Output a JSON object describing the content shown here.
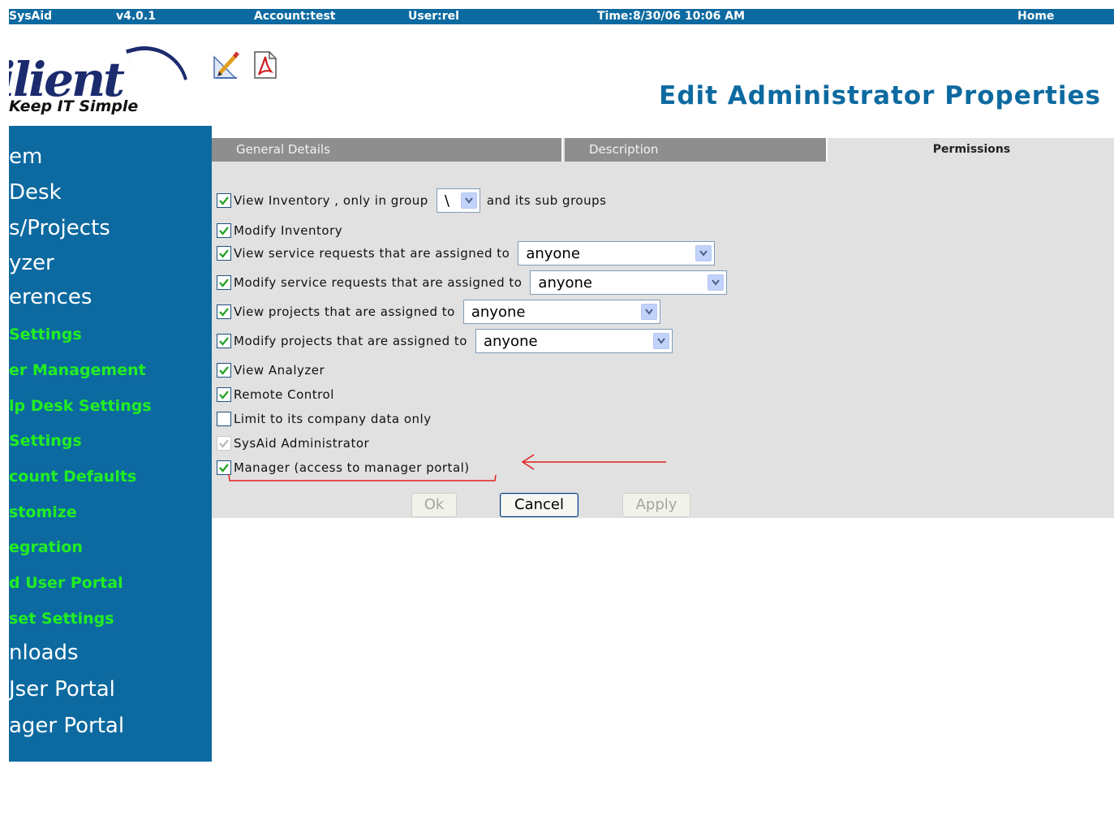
{
  "topbar": {
    "app": "SysAid",
    "version": "v4.0.1",
    "account": "Account:test",
    "user": "User:rel",
    "time": "Time:8/30/06 10:06 AM",
    "home": "Home"
  },
  "logo": {
    "text": "ilient",
    "tagline": "Keep IT Simple"
  },
  "toolbar": {
    "icons": [
      "edit-icon",
      "pdf-icon"
    ]
  },
  "page_title": "Edit Administrator Properties",
  "sidebar": {
    "items": [
      {
        "label": "em"
      },
      {
        "label": "Desk"
      },
      {
        "label": "s/Projects"
      },
      {
        "label": "yzer"
      },
      {
        "label": "erences"
      },
      {
        "label": "Settings"
      },
      {
        "label": "er Management"
      },
      {
        "label": "lp Desk Settings"
      },
      {
        "label": "Settings"
      },
      {
        "label": "count Defaults"
      },
      {
        "label": "stomize"
      },
      {
        "label": "egration"
      },
      {
        "label": "d User Portal"
      },
      {
        "label": "set Settings"
      },
      {
        "label": "nloads"
      },
      {
        "label": "Jser Portal"
      },
      {
        "label": "ager Portal"
      }
    ]
  },
  "tabs": [
    {
      "label": "General Details"
    },
    {
      "label": "Description"
    },
    {
      "label": "Permissions",
      "active": true
    }
  ],
  "permissions": {
    "view_inventory": {
      "checked": true,
      "label": "View Inventory , only in group",
      "group": "\\",
      "suffix": "and its sub groups"
    },
    "modify_inventory": {
      "checked": true,
      "label": "Modify Inventory"
    },
    "view_sr": {
      "checked": true,
      "label": "View service requests that are assigned to",
      "value": "anyone"
    },
    "modify_sr": {
      "checked": true,
      "label": "Modify service requests that are assigned to",
      "value": "anyone"
    },
    "view_projects": {
      "checked": true,
      "label": "View projects that are assigned to",
      "value": "anyone"
    },
    "modify_projects": {
      "checked": true,
      "label": "Modify projects that are assigned to",
      "value": "anyone"
    },
    "view_analyzer": {
      "checked": true,
      "label": "View Analyzer"
    },
    "remote_control": {
      "checked": true,
      "label": "Remote Control"
    },
    "limit_company": {
      "checked": false,
      "label": "Limit to its company data only"
    },
    "sysaid_admin": {
      "checked": true,
      "disabled": true,
      "label": "SysAid Administrator"
    },
    "manager": {
      "checked": true,
      "label": "Manager (access to manager portal)"
    }
  },
  "buttons": {
    "ok": "Ok",
    "cancel": "Cancel",
    "apply": "Apply"
  },
  "annotation_color": "#e02020"
}
